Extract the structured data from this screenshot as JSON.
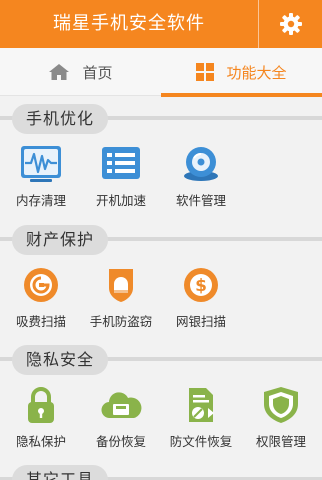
{
  "app": {
    "title": "瑞星手机安全软件"
  },
  "header": {
    "settings_icon": "gear-icon"
  },
  "tabs": [
    {
      "label": "首页",
      "icon": "home-icon",
      "active": false
    },
    {
      "label": "功能大全",
      "icon": "grid-icon",
      "active": true
    }
  ],
  "sections": [
    {
      "title": "手机优化",
      "items": [
        {
          "label": "内存清理",
          "icon": "memory-icon"
        },
        {
          "label": "开机加速",
          "icon": "boot-speed-icon"
        },
        {
          "label": "软件管理",
          "icon": "software-manager-icon"
        }
      ]
    },
    {
      "title": "财产保护",
      "items": [
        {
          "label": "吸费扫描",
          "icon": "fee-scan-icon"
        },
        {
          "label": "手机防盗窃",
          "icon": "anti-theft-icon"
        },
        {
          "label": "网银扫描",
          "icon": "bank-scan-icon"
        }
      ]
    },
    {
      "title": "隐私安全",
      "items": [
        {
          "label": "隐私保护",
          "icon": "lock-icon"
        },
        {
          "label": "备份恢复",
          "icon": "cloud-backup-icon"
        },
        {
          "label": "防文件恢复",
          "icon": "file-shred-icon"
        },
        {
          "label": "权限管理",
          "icon": "permission-shield-icon"
        }
      ]
    },
    {
      "title": "其它工具",
      "items": []
    }
  ],
  "colors": {
    "accent": "#f5861f",
    "blue": "#3d8fd6",
    "orange_icon": "#ef8a2a",
    "green_icon": "#8ab34a"
  }
}
